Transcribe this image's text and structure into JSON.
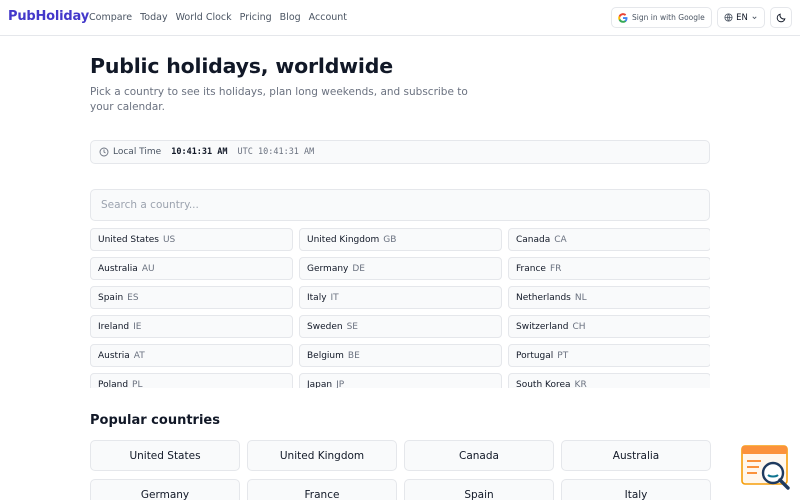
{
  "brand": {
    "name": "PubHoliday",
    "accent_color": "#4338ca"
  },
  "nav": {
    "items": [
      {
        "label": "Compare"
      },
      {
        "label": "Today"
      },
      {
        "label": "World Clock"
      },
      {
        "label": "Pricing"
      },
      {
        "label": "Blog"
      },
      {
        "label": "Account"
      }
    ]
  },
  "header": {
    "google_button_label": "Sign in with Google",
    "google_icon": "google-icon",
    "language": "EN",
    "language_icon": "globe-icon",
    "theme_icon": "moon-icon"
  },
  "hero": {
    "title": "Public holidays, worldwide",
    "subtitle": "Pick a country to see its holidays, plan long weekends, and subscribe to your calendar."
  },
  "local_time": {
    "label": "Local Time",
    "time": "10:41:31 AM",
    "utc": "UTC 10:41:31 AM",
    "icon": "clock-icon"
  },
  "search": {
    "placeholder": "Search a country...",
    "value": ""
  },
  "countries": [
    {
      "name": "United States",
      "code": "US"
    },
    {
      "name": "United Kingdom",
      "code": "GB"
    },
    {
      "name": "Canada",
      "code": "CA"
    },
    {
      "name": "Australia",
      "code": "AU"
    },
    {
      "name": "Germany",
      "code": "DE"
    },
    {
      "name": "France",
      "code": "FR"
    },
    {
      "name": "Spain",
      "code": "ES"
    },
    {
      "name": "Italy",
      "code": "IT"
    },
    {
      "name": "Netherlands",
      "code": "NL"
    },
    {
      "name": "Ireland",
      "code": "IE"
    },
    {
      "name": "Sweden",
      "code": "SE"
    },
    {
      "name": "Switzerland",
      "code": "CH"
    },
    {
      "name": "Austria",
      "code": "AT"
    },
    {
      "name": "Belgium",
      "code": "BE"
    },
    {
      "name": "Portugal",
      "code": "PT"
    },
    {
      "name": "Poland",
      "code": "PL"
    },
    {
      "name": "Japan",
      "code": "JP"
    },
    {
      "name": "South Korea",
      "code": "KR"
    }
  ],
  "popular": {
    "title": "Popular countries",
    "items": [
      "United States",
      "United Kingdom",
      "Canada",
      "Australia",
      "Germany",
      "France",
      "Spain",
      "Italy"
    ]
  },
  "widget": {
    "icon": "search-support-icon"
  }
}
